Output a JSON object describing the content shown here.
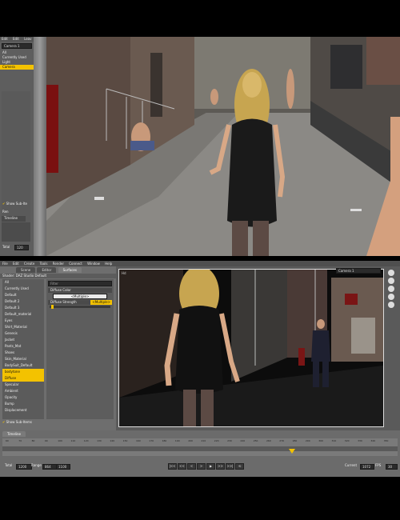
{
  "top": {
    "menu": [
      "Edit",
      "Edit",
      "Leav"
    ],
    "camera_dropdown": "Camera 1",
    "list_items": [
      "All",
      "Currently Used",
      "Light",
      "Camera"
    ],
    "show_sub_items": "Show Sub-Ite",
    "panel_tab": "Timeline",
    "fields": [
      "Total",
      "120"
    ],
    "labels": [
      "Ren",
      "Ren"
    ]
  },
  "bottom": {
    "menu": [
      "File",
      "Edit",
      "Create",
      "Tools",
      "Render",
      "Connect",
      "Window",
      "Help"
    ],
    "tabs": [
      "Scene",
      "Editor",
      "Surfaces"
    ],
    "preset_label": "Shader: DAZ Studio Default",
    "left_items": [
      {
        "label": "All",
        "selected": false
      },
      {
        "label": "Currently Used",
        "selected": false
      },
      {
        "label": "Default",
        "selected": false
      },
      {
        "label": "Default 2",
        "selected": false
      },
      {
        "label": "Default 3",
        "selected": false
      },
      {
        "label": "Default_material",
        "selected": false
      },
      {
        "label": "Eyes",
        "selected": false
      },
      {
        "label": "Shirt_Material",
        "selected": false
      },
      {
        "label": "Genesis",
        "selected": false
      },
      {
        "label": "Jacket",
        "selected": false
      },
      {
        "label": "Pants_Mat",
        "selected": false
      },
      {
        "label": "Shoes",
        "selected": false
      },
      {
        "label": "Skin_Material",
        "selected": false
      },
      {
        "label": "BodySuit_Default",
        "selected": false
      },
      {
        "label": "bodytone",
        "selected": true
      },
      {
        "label": "Diffuse",
        "selected": true
      },
      {
        "label": "Specular",
        "selected": false
      },
      {
        "label": "Ambient",
        "selected": false
      },
      {
        "label": "Opacity",
        "selected": false
      },
      {
        "label": "Bump",
        "selected": false
      },
      {
        "label": "Displacement",
        "selected": false
      }
    ],
    "show_sub_items": "Show Sub-Items",
    "search_placeholder": "Filter",
    "properties": {
      "diffuse_color_label": "Diffuse Color",
      "diffuse_color_value": "<Multiple>",
      "diffuse_strength_label": "Diffuse Strength",
      "diffuse_strength_value": "<Multiple>"
    },
    "viewport_label": "Camera 1",
    "viewport_tag": "Hd",
    "timeline_tab": "Timeline",
    "ruler_ticks": [
      "60",
      "70",
      "80",
      "90",
      "100",
      "110",
      "120",
      "130",
      "140",
      "150",
      "160",
      "170",
      "180",
      "190",
      "200",
      "210",
      "220",
      "230",
      "240",
      "250",
      "260",
      "270",
      "280",
      "290",
      "300",
      "310",
      "320",
      "330",
      "340",
      "350"
    ],
    "total_label": "Total",
    "total_value": "1200",
    "range_label": "Range",
    "range_start": "864",
    "range_end": "1100",
    "current_label": "Current",
    "current_value": "1072",
    "fps_label": "FPS",
    "fps_value": "30",
    "play_controls": [
      "|<<",
      "<<",
      "<",
      ">",
      "▶",
      ">>",
      ">>|",
      "⟲"
    ]
  },
  "colors": {
    "accent": "#f3c200",
    "panel": "#6d6d6d",
    "dark": "#4e4e4e"
  }
}
